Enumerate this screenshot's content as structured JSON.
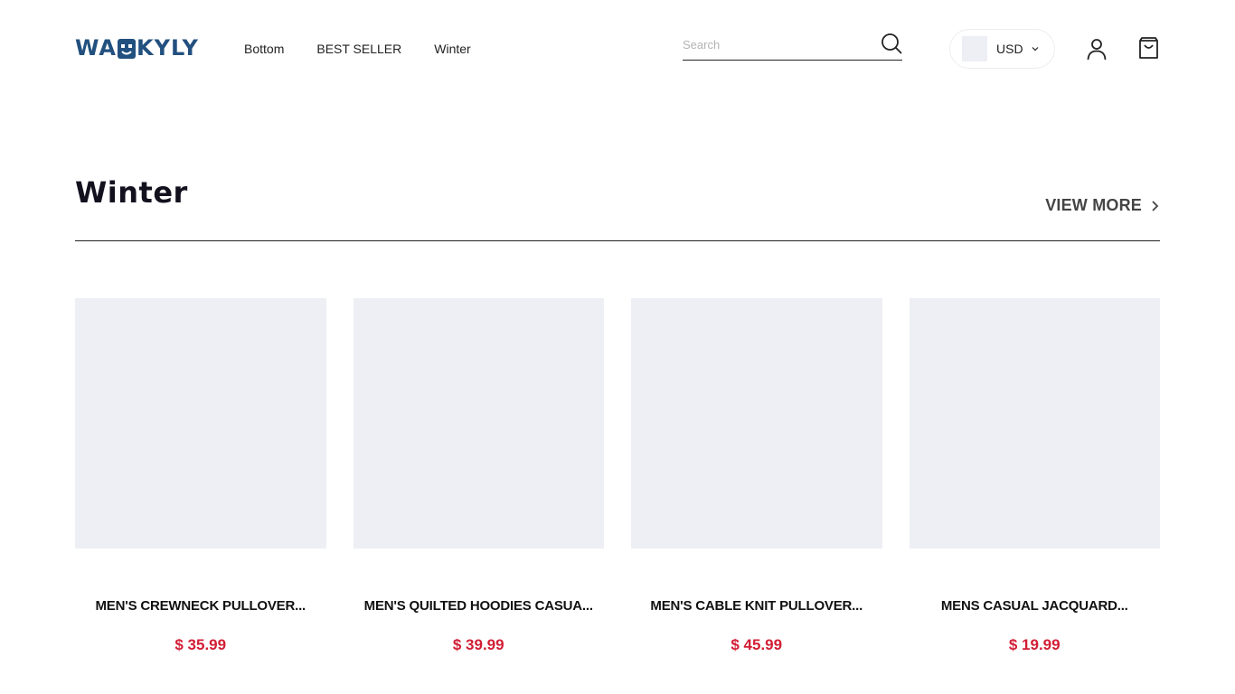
{
  "brand": {
    "logo_left": "WA",
    "logo_right": "KYLY",
    "color": "#22507f"
  },
  "nav": {
    "items": [
      {
        "label": "Bottom"
      },
      {
        "label": "BEST SELLER"
      },
      {
        "label": "Winter"
      }
    ]
  },
  "search": {
    "placeholder": "Search",
    "value": ""
  },
  "currency": {
    "label": "USD"
  },
  "section": {
    "title": "Winter",
    "view_more_label": "VIEW MORE"
  },
  "products": [
    {
      "name": "MEN'S CREWNECK PULLOVER...",
      "price": "$ 35.99"
    },
    {
      "name": "MEN'S QUILTED HOODIES CASUA...",
      "price": "$ 39.99"
    },
    {
      "name": "MEN'S CABLE KNIT PULLOVER...",
      "price": "$ 45.99"
    },
    {
      "name": "MENS CASUAL JACQUARD...",
      "price": "$ 19.99"
    }
  ],
  "colors": {
    "price": "#d21e35",
    "placeholder_bg": "#eeeff4"
  },
  "icons": [
    "search-icon",
    "chevron-down-icon",
    "user-icon",
    "shopping-bag-icon",
    "chevron-right-icon"
  ]
}
